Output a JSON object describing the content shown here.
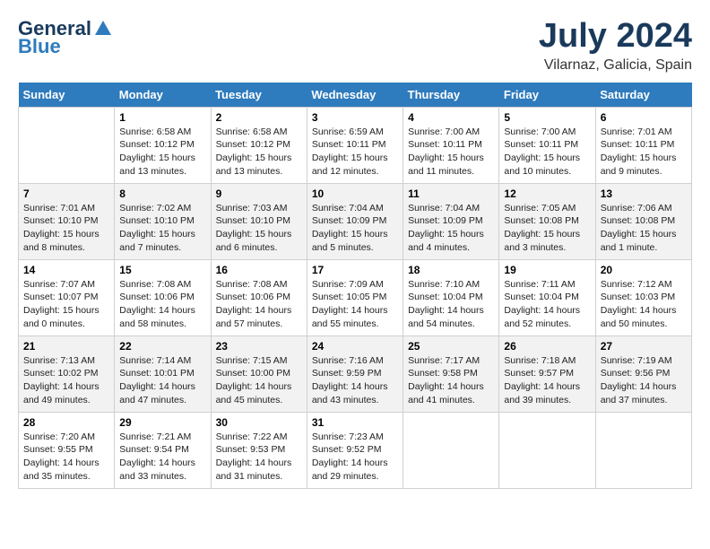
{
  "logo": {
    "general": "General",
    "blue": "Blue"
  },
  "title": "July 2024",
  "location": "Vilarnaz, Galicia, Spain",
  "days_of_week": [
    "Sunday",
    "Monday",
    "Tuesday",
    "Wednesday",
    "Thursday",
    "Friday",
    "Saturday"
  ],
  "weeks": [
    [
      {
        "day": "",
        "info": ""
      },
      {
        "day": "1",
        "info": "Sunrise: 6:58 AM\nSunset: 10:12 PM\nDaylight: 15 hours\nand 13 minutes."
      },
      {
        "day": "2",
        "info": "Sunrise: 6:58 AM\nSunset: 10:12 PM\nDaylight: 15 hours\nand 13 minutes."
      },
      {
        "day": "3",
        "info": "Sunrise: 6:59 AM\nSunset: 10:11 PM\nDaylight: 15 hours\nand 12 minutes."
      },
      {
        "day": "4",
        "info": "Sunrise: 7:00 AM\nSunset: 10:11 PM\nDaylight: 15 hours\nand 11 minutes."
      },
      {
        "day": "5",
        "info": "Sunrise: 7:00 AM\nSunset: 10:11 PM\nDaylight: 15 hours\nand 10 minutes."
      },
      {
        "day": "6",
        "info": "Sunrise: 7:01 AM\nSunset: 10:11 PM\nDaylight: 15 hours\nand 9 minutes."
      }
    ],
    [
      {
        "day": "7",
        "info": "Sunrise: 7:01 AM\nSunset: 10:10 PM\nDaylight: 15 hours\nand 8 minutes."
      },
      {
        "day": "8",
        "info": "Sunrise: 7:02 AM\nSunset: 10:10 PM\nDaylight: 15 hours\nand 7 minutes."
      },
      {
        "day": "9",
        "info": "Sunrise: 7:03 AM\nSunset: 10:10 PM\nDaylight: 15 hours\nand 6 minutes."
      },
      {
        "day": "10",
        "info": "Sunrise: 7:04 AM\nSunset: 10:09 PM\nDaylight: 15 hours\nand 5 minutes."
      },
      {
        "day": "11",
        "info": "Sunrise: 7:04 AM\nSunset: 10:09 PM\nDaylight: 15 hours\nand 4 minutes."
      },
      {
        "day": "12",
        "info": "Sunrise: 7:05 AM\nSunset: 10:08 PM\nDaylight: 15 hours\nand 3 minutes."
      },
      {
        "day": "13",
        "info": "Sunrise: 7:06 AM\nSunset: 10:08 PM\nDaylight: 15 hours\nand 1 minute."
      }
    ],
    [
      {
        "day": "14",
        "info": "Sunrise: 7:07 AM\nSunset: 10:07 PM\nDaylight: 15 hours\nand 0 minutes."
      },
      {
        "day": "15",
        "info": "Sunrise: 7:08 AM\nSunset: 10:06 PM\nDaylight: 14 hours\nand 58 minutes."
      },
      {
        "day": "16",
        "info": "Sunrise: 7:08 AM\nSunset: 10:06 PM\nDaylight: 14 hours\nand 57 minutes."
      },
      {
        "day": "17",
        "info": "Sunrise: 7:09 AM\nSunset: 10:05 PM\nDaylight: 14 hours\nand 55 minutes."
      },
      {
        "day": "18",
        "info": "Sunrise: 7:10 AM\nSunset: 10:04 PM\nDaylight: 14 hours\nand 54 minutes."
      },
      {
        "day": "19",
        "info": "Sunrise: 7:11 AM\nSunset: 10:04 PM\nDaylight: 14 hours\nand 52 minutes."
      },
      {
        "day": "20",
        "info": "Sunrise: 7:12 AM\nSunset: 10:03 PM\nDaylight: 14 hours\nand 50 minutes."
      }
    ],
    [
      {
        "day": "21",
        "info": "Sunrise: 7:13 AM\nSunset: 10:02 PM\nDaylight: 14 hours\nand 49 minutes."
      },
      {
        "day": "22",
        "info": "Sunrise: 7:14 AM\nSunset: 10:01 PM\nDaylight: 14 hours\nand 47 minutes."
      },
      {
        "day": "23",
        "info": "Sunrise: 7:15 AM\nSunset: 10:00 PM\nDaylight: 14 hours\nand 45 minutes."
      },
      {
        "day": "24",
        "info": "Sunrise: 7:16 AM\nSunset: 9:59 PM\nDaylight: 14 hours\nand 43 minutes."
      },
      {
        "day": "25",
        "info": "Sunrise: 7:17 AM\nSunset: 9:58 PM\nDaylight: 14 hours\nand 41 minutes."
      },
      {
        "day": "26",
        "info": "Sunrise: 7:18 AM\nSunset: 9:57 PM\nDaylight: 14 hours\nand 39 minutes."
      },
      {
        "day": "27",
        "info": "Sunrise: 7:19 AM\nSunset: 9:56 PM\nDaylight: 14 hours\nand 37 minutes."
      }
    ],
    [
      {
        "day": "28",
        "info": "Sunrise: 7:20 AM\nSunset: 9:55 PM\nDaylight: 14 hours\nand 35 minutes."
      },
      {
        "day": "29",
        "info": "Sunrise: 7:21 AM\nSunset: 9:54 PM\nDaylight: 14 hours\nand 33 minutes."
      },
      {
        "day": "30",
        "info": "Sunrise: 7:22 AM\nSunset: 9:53 PM\nDaylight: 14 hours\nand 31 minutes."
      },
      {
        "day": "31",
        "info": "Sunrise: 7:23 AM\nSunset: 9:52 PM\nDaylight: 14 hours\nand 29 minutes."
      },
      {
        "day": "",
        "info": ""
      },
      {
        "day": "",
        "info": ""
      },
      {
        "day": "",
        "info": ""
      }
    ]
  ]
}
